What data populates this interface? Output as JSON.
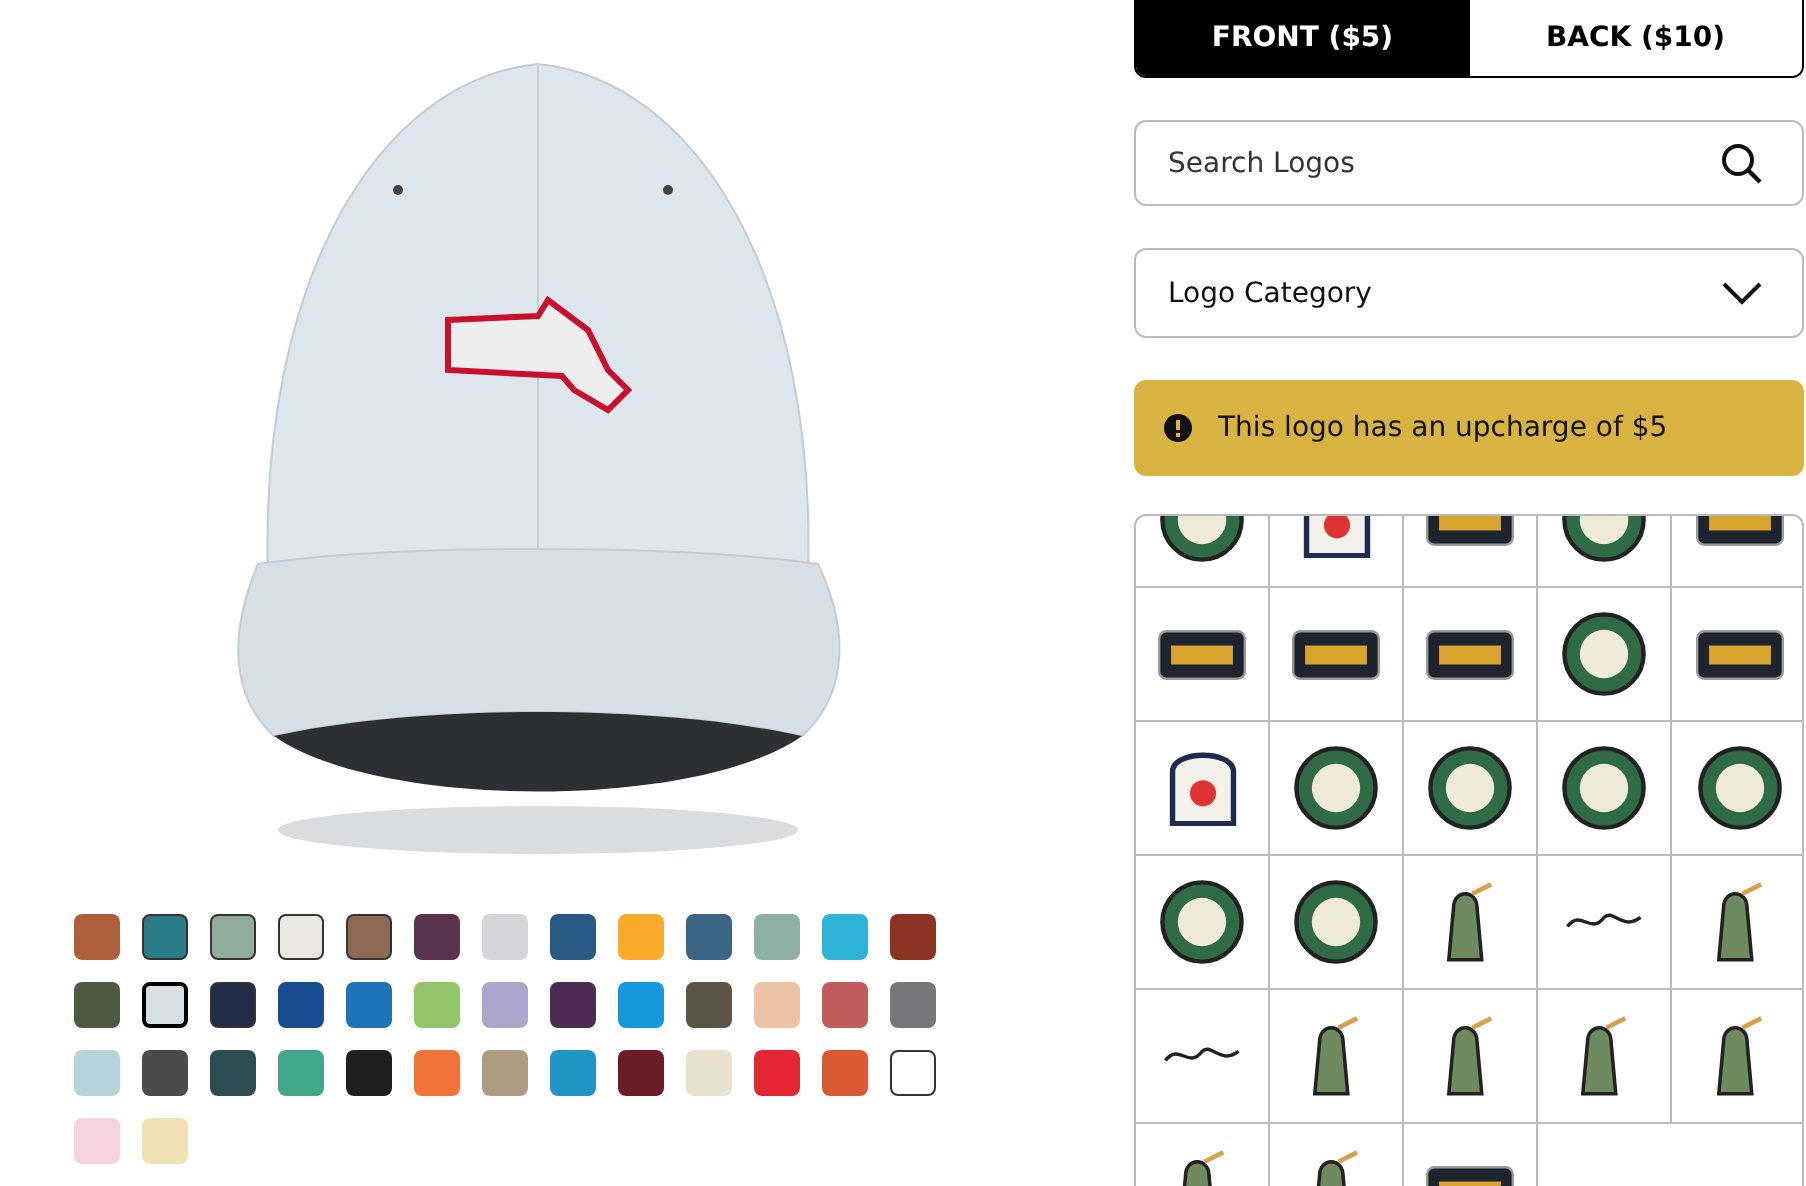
{
  "tabs": [
    {
      "label": "FRONT ($5)",
      "selected": true
    },
    {
      "label": "BACK ($10)",
      "selected": false
    }
  ],
  "search": {
    "placeholder": "Search Logos"
  },
  "category_select": {
    "label": "Logo Category"
  },
  "alert": {
    "text": "This logo has an upcharge of $5"
  },
  "swatches": [
    {
      "color": "#ad603a",
      "selected": false,
      "outlined": false
    },
    {
      "color": "#2a7c88",
      "selected": false,
      "outlined": true
    },
    {
      "color": "#91ab9a",
      "selected": false,
      "outlined": true
    },
    {
      "color": "#ebe8e1",
      "selected": false,
      "outlined": true
    },
    {
      "color": "#8e6a55",
      "selected": false,
      "outlined": true
    },
    {
      "color": "#5a344c",
      "selected": false,
      "outlined": false
    },
    {
      "color": "#d4d5d9",
      "selected": false,
      "outlined": false
    },
    {
      "color": "#2a5a84",
      "selected": false,
      "outlined": false
    },
    {
      "color": "#fbaa2c",
      "selected": false,
      "outlined": false
    },
    {
      "color": "#3a6584",
      "selected": false,
      "outlined": false
    },
    {
      "color": "#8fb0a5",
      "selected": false,
      "outlined": false
    },
    {
      "color": "#2eb2d6",
      "selected": false,
      "outlined": false
    },
    {
      "color": "#8c3424",
      "selected": false,
      "outlined": false
    },
    {
      "color": "#4c5a42",
      "selected": false,
      "outlined": false
    },
    {
      "color": "#d7dfe2",
      "selected": true,
      "outlined": true
    },
    {
      "color": "#222e48",
      "selected": false,
      "outlined": true
    },
    {
      "color": "#1a4c90",
      "selected": false,
      "outlined": false
    },
    {
      "color": "#1e74b6",
      "selected": false,
      "outlined": false
    },
    {
      "color": "#91c567",
      "selected": false,
      "outlined": false
    },
    {
      "color": "#aaa6cc",
      "selected": false,
      "outlined": false
    },
    {
      "color": "#4e2b54",
      "selected": false,
      "outlined": false
    },
    {
      "color": "#1598dc",
      "selected": false,
      "outlined": false
    },
    {
      "color": "#5c5444",
      "selected": false,
      "outlined": false
    },
    {
      "color": "#ecc2a5",
      "selected": false,
      "outlined": false
    },
    {
      "color": "#c45c5c",
      "selected": false,
      "outlined": false
    },
    {
      "color": "#77777b",
      "selected": false,
      "outlined": false
    },
    {
      "color": "#b4d4da",
      "selected": false,
      "outlined": false
    },
    {
      "color": "#4b4b4d",
      "selected": false,
      "outlined": false
    },
    {
      "color": "#2d4c53",
      "selected": false,
      "outlined": false
    },
    {
      "color": "#42a68c",
      "selected": false,
      "outlined": false
    },
    {
      "color": "#1f1f1f",
      "selected": false,
      "outlined": false
    },
    {
      "color": "#f0733a",
      "selected": false,
      "outlined": false
    },
    {
      "color": "#ae9c82",
      "selected": false,
      "outlined": false
    },
    {
      "color": "#2194c4",
      "selected": false,
      "outlined": false
    },
    {
      "color": "#6c1c24",
      "selected": false,
      "outlined": false
    },
    {
      "color": "#e8e2ce",
      "selected": false,
      "outlined": false
    },
    {
      "color": "#e42632",
      "selected": false,
      "outlined": false
    },
    {
      "color": "#da5a36",
      "selected": false,
      "outlined": false
    },
    {
      "color": "#ffffff",
      "selected": false,
      "outlined": true
    },
    {
      "color": "#f7d2e1",
      "selected": false,
      "outlined": false
    },
    {
      "color": "#f0e2b5",
      "selected": false,
      "outlined": false
    }
  ],
  "logos": [
    {
      "kind": "round"
    },
    {
      "kind": "badge"
    },
    {
      "kind": "rect"
    },
    {
      "kind": "round"
    },
    {
      "kind": "rect"
    },
    {
      "kind": "rect"
    },
    {
      "kind": "rect"
    },
    {
      "kind": "rect"
    },
    {
      "kind": "round"
    },
    {
      "kind": "rect"
    },
    {
      "kind": "badge"
    },
    {
      "kind": "round"
    },
    {
      "kind": "round"
    },
    {
      "kind": "round"
    },
    {
      "kind": "round"
    },
    {
      "kind": "round"
    },
    {
      "kind": "round"
    },
    {
      "kind": "figure"
    },
    {
      "kind": "script"
    },
    {
      "kind": "figure"
    },
    {
      "kind": "script"
    },
    {
      "kind": "figure"
    },
    {
      "kind": "figure"
    },
    {
      "kind": "figure"
    },
    {
      "kind": "figure"
    },
    {
      "kind": "figure"
    },
    {
      "kind": "figure"
    },
    {
      "kind": "rect"
    }
  ]
}
